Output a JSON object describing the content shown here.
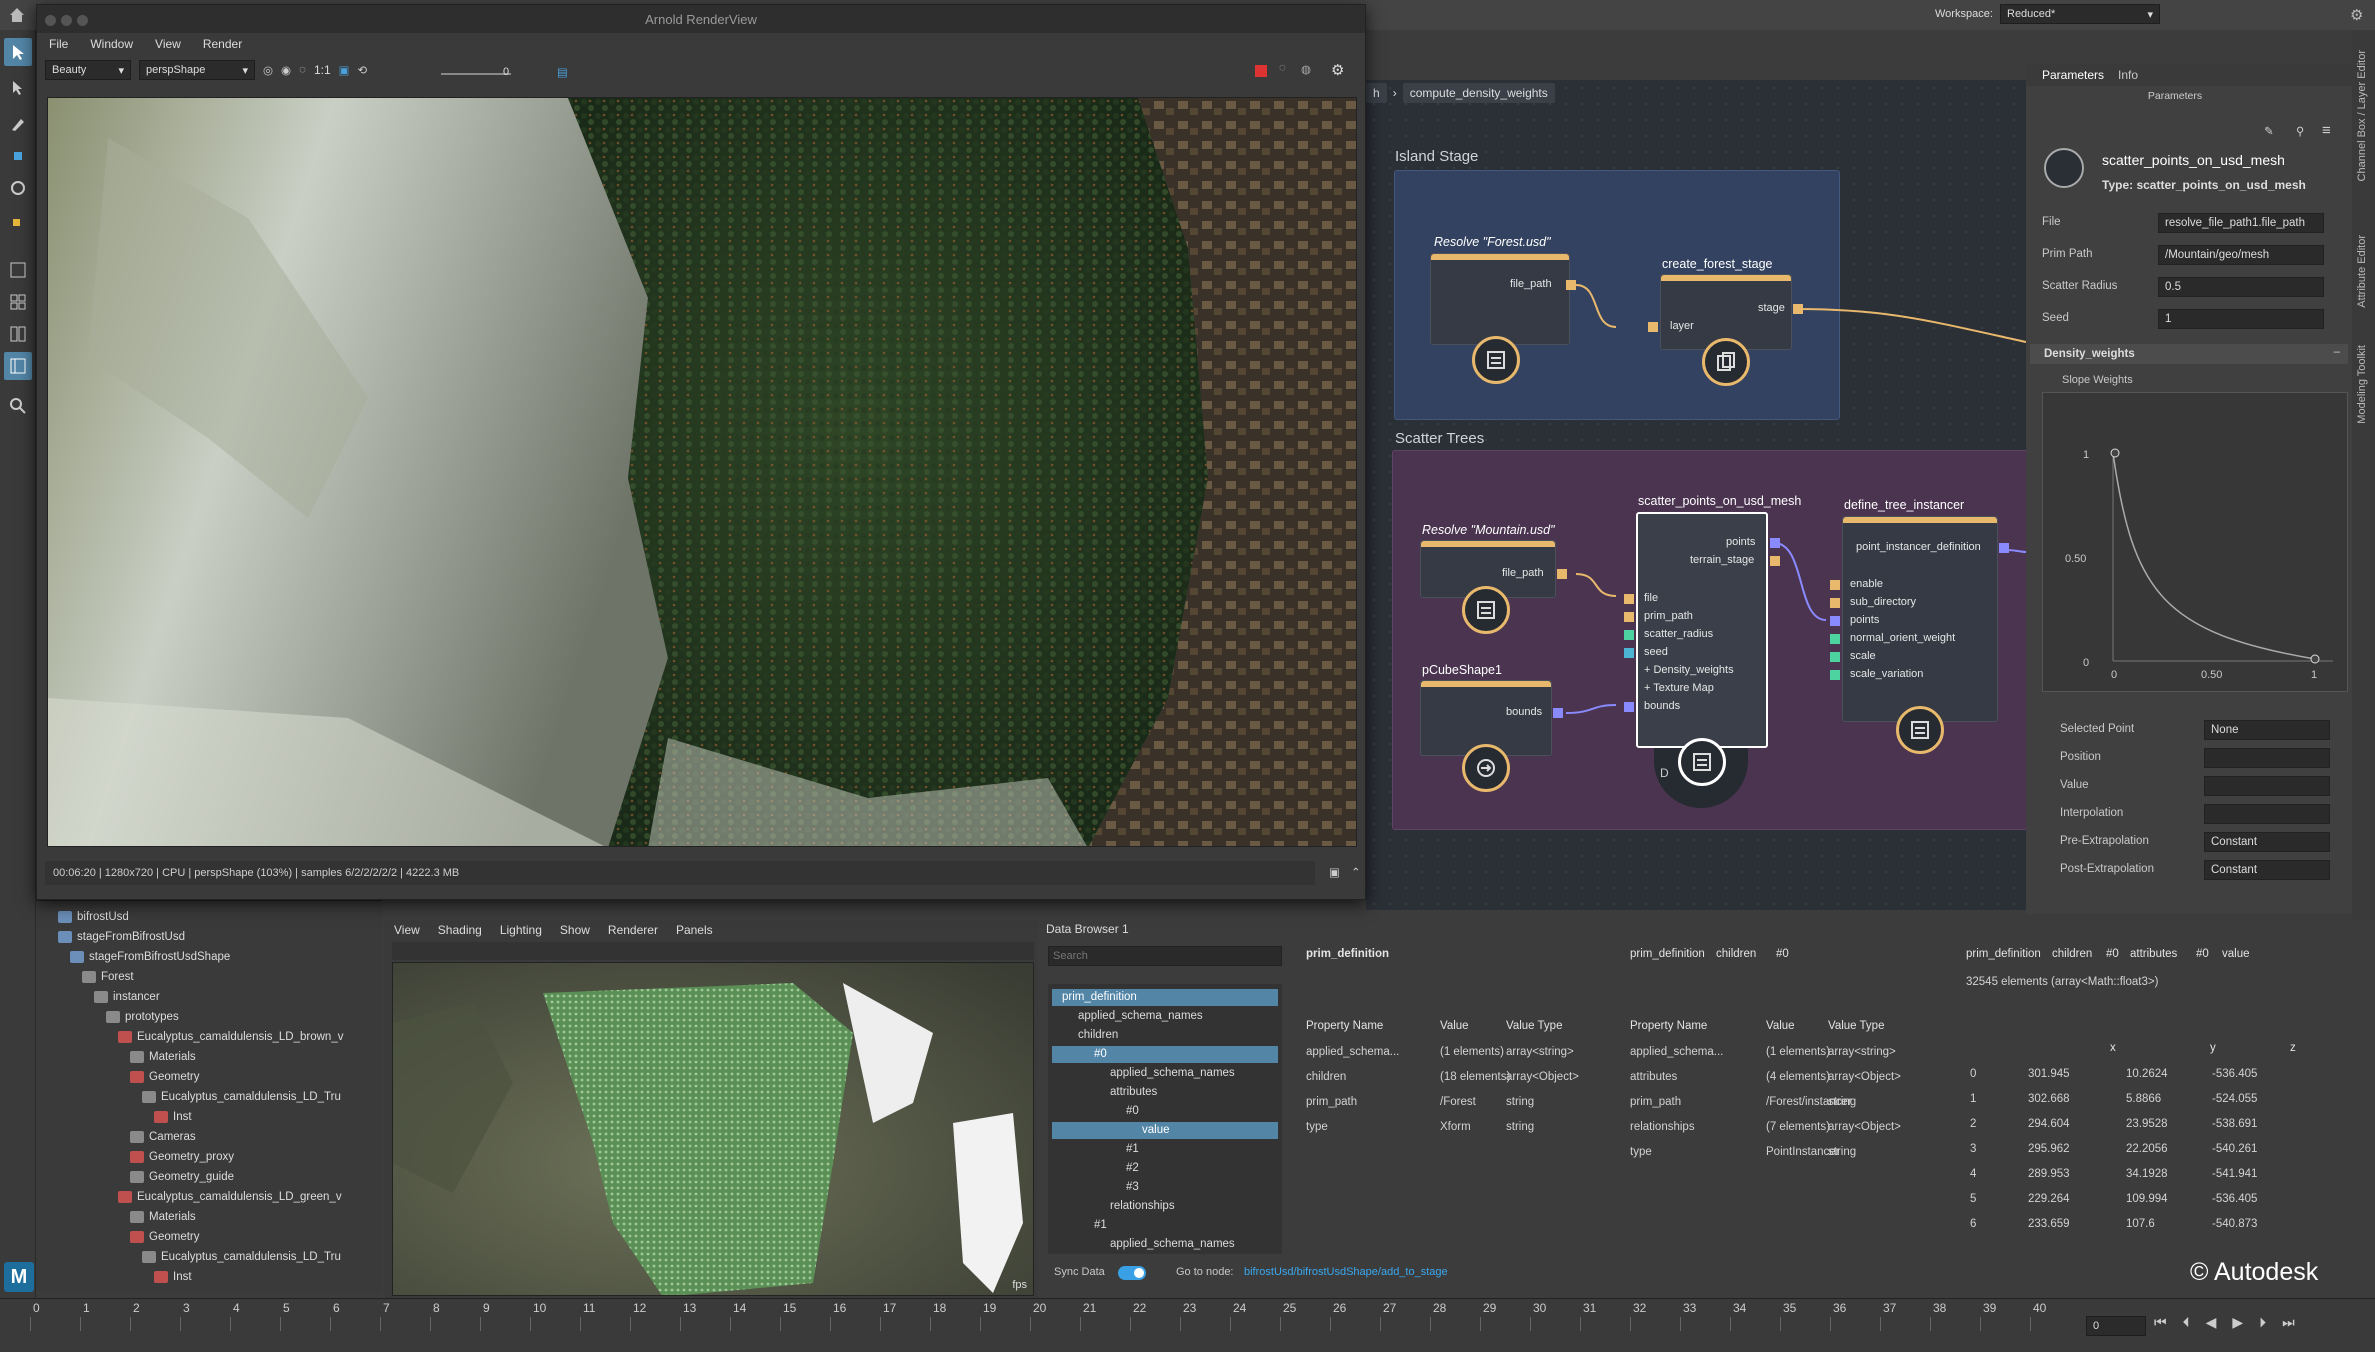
{
  "workspace": {
    "label": "Workspace:",
    "value": "Reduced*"
  },
  "renderview": {
    "title": "Arnold RenderView",
    "menu": [
      "File",
      "Window",
      "View",
      "Render"
    ],
    "aov": "Beauty",
    "camera": "perspShape",
    "ratio": "1:1",
    "exposure": "0",
    "status": "00:06:20 | 1280x720 | CPU | perspShape (103%) | samples 6/2/2/2/2/2 | 4222.3 MB"
  },
  "node_editor": {
    "breadcrumb": [
      "h",
      "compute_density_weights"
    ],
    "backdrops": {
      "island": "Island Stage",
      "scatter": "Scatter Trees"
    },
    "nodes": {
      "resolve_forest": {
        "title": "Resolve \"Forest.usd\"",
        "port": "file_path"
      },
      "create_forest_stage": {
        "title": "create_forest_stage",
        "in": "layer",
        "out": "stage"
      },
      "resolve_mountain": {
        "title": "Resolve \"Mountain.usd\"",
        "port": "file_path"
      },
      "pcube": {
        "title": "pCubeShape1",
        "port": "bounds"
      },
      "scatter": {
        "title": "scatter_points_on_usd_mesh",
        "outs": [
          "points",
          "terrain_stage"
        ],
        "ins": [
          "file",
          "prim_path",
          "scatter_radius",
          "seed",
          "+ Density_weights",
          "+ Texture Map",
          "bounds"
        ],
        "badge": "D"
      },
      "instancer": {
        "title": "define_tree_instancer",
        "out": "point_instancer_definition",
        "ins": [
          "enable",
          "sub_directory",
          "points",
          "normal_orient_weight",
          "scale",
          "scale_variation"
        ]
      }
    }
  },
  "params": {
    "tabs": [
      "Parameters",
      "Info"
    ],
    "header": "Parameters",
    "node_name": "scatter_points_on_usd_mesh",
    "node_type": "Type: scatter_points_on_usd_mesh",
    "fields": [
      {
        "label": "File",
        "value": "resolve_file_path1.file_path"
      },
      {
        "label": "Prim Path",
        "value": "/Mountain/geo/mesh"
      },
      {
        "label": "Scatter Radius",
        "value": "0.5"
      },
      {
        "label": "Seed",
        "value": "1"
      }
    ],
    "section": "Density_weights",
    "ramp_label": "Slope Weights",
    "ramp": {
      "y_ticks": [
        "1",
        "0.50",
        "0"
      ],
      "x_ticks": [
        "0",
        "0.50",
        "1"
      ]
    },
    "ramp_fields": [
      {
        "label": "Selected Point",
        "value": "None"
      },
      {
        "label": "Position",
        "value": ""
      },
      {
        "label": "Value",
        "value": ""
      },
      {
        "label": "Interpolation",
        "value": ""
      },
      {
        "label": "Pre-Extrapolation",
        "value": "Constant"
      },
      {
        "label": "Post-Extrapolation",
        "value": "Constant"
      }
    ]
  },
  "side_tabs": [
    "Channel Box / Layer Editor",
    "Attribute Editor",
    "Modeling Toolkit"
  ],
  "outliner": [
    {
      "label": "bifrostUsd",
      "indent": 0
    },
    {
      "label": "stageFromBifrostUsd",
      "indent": 0
    },
    {
      "label": "stageFromBifrostUsdShape",
      "indent": 1
    },
    {
      "label": "Forest",
      "indent": 2
    },
    {
      "label": "instancer",
      "indent": 3
    },
    {
      "label": "prototypes",
      "indent": 4
    },
    {
      "label": "Eucalyptus_camaldulensis_LD_brown_v",
      "indent": 5
    },
    {
      "label": "Materials",
      "indent": 6
    },
    {
      "label": "Geometry",
      "indent": 6
    },
    {
      "label": "Eucalyptus_camaldulensis_LD_Tru",
      "indent": 7
    },
    {
      "label": "Inst",
      "indent": 8
    },
    {
      "label": "Cameras",
      "indent": 6
    },
    {
      "label": "Geometry_proxy",
      "indent": 6
    },
    {
      "label": "Geometry_guide",
      "indent": 6
    },
    {
      "label": "Eucalyptus_camaldulensis_LD_green_v",
      "indent": 5
    },
    {
      "label": "Materials",
      "indent": 6
    },
    {
      "label": "Geometry",
      "indent": 6
    },
    {
      "label": "Eucalyptus_camaldulensis_LD_Tru",
      "indent": 7
    },
    {
      "label": "Inst",
      "indent": 8
    }
  ],
  "viewport": {
    "menu": [
      "View",
      "Shading",
      "Lighting",
      "Show",
      "Renderer",
      "Panels"
    ],
    "fps": "fps"
  },
  "data_browser": {
    "tab": "Data Browser 1",
    "search_placeholder": "Search",
    "tree": [
      {
        "label": "prim_definition",
        "indent": 0,
        "hl": true
      },
      {
        "label": "applied_schema_names",
        "indent": 1
      },
      {
        "label": "children",
        "indent": 1
      },
      {
        "label": "#0",
        "indent": 2,
        "hl": true
      },
      {
        "label": "applied_schema_names",
        "indent": 3
      },
      {
        "label": "attributes",
        "indent": 3
      },
      {
        "label": "#0",
        "indent": 4
      },
      {
        "label": "value",
        "indent": 5,
        "hl": true
      },
      {
        "label": "#1",
        "indent": 4
      },
      {
        "label": "#2",
        "indent": 4
      },
      {
        "label": "#3",
        "indent": 4
      },
      {
        "label": "relationships",
        "indent": 3
      },
      {
        "label": "#1",
        "indent": 2
      },
      {
        "label": "applied_schema_names",
        "indent": 3
      }
    ],
    "panel1": {
      "path": "prim_definition",
      "headers": [
        "Property Name",
        "Value",
        "Value Type"
      ],
      "rows": [
        [
          "applied_schema...",
          "(1 elements)",
          "array<string>"
        ],
        [
          "children",
          "(18 elements)",
          "array<Object>"
        ],
        [
          "prim_path",
          "/Forest",
          "string"
        ],
        [
          "type",
          "Xform",
          "string"
        ]
      ]
    },
    "panel2": {
      "path": [
        "prim_definition",
        "children",
        "#0"
      ],
      "headers": [
        "Property Name",
        "Value",
        "Value Type"
      ],
      "rows": [
        [
          "applied_schema...",
          "(1 elements)",
          "array<string>"
        ],
        [
          "attributes",
          "(4 elements)",
          "array<Object>"
        ],
        [
          "prim_path",
          "/Forest/instancer",
          "string"
        ],
        [
          "relationships",
          "(7 elements)",
          "array<Object>"
        ],
        [
          "type",
          "PointInstancer",
          "string"
        ]
      ]
    },
    "panel3": {
      "path": [
        "prim_definition",
        "children",
        "#0",
        "attributes",
        "#0",
        "value"
      ],
      "summary": "32545 elements (array<Math::float3>)",
      "headers": [
        "x",
        "y",
        "z"
      ],
      "rows": [
        [
          "0",
          "301.945",
          "10.2624",
          "-536.405"
        ],
        [
          "1",
          "302.668",
          "5.8866",
          "-524.055"
        ],
        [
          "2",
          "294.604",
          "23.9528",
          "-538.691"
        ],
        [
          "3",
          "295.962",
          "22.2056",
          "-540.261"
        ],
        [
          "4",
          "289.953",
          "34.1928",
          "-541.941"
        ],
        [
          "5",
          "229.264",
          "109.994",
          "-536.405"
        ],
        [
          "6",
          "233.659",
          "107.6",
          "-540.873"
        ]
      ]
    },
    "sync_label": "Sync Data",
    "goto_label": "Go to node:",
    "goto_path": "bifrostUsd/bifrostUsdShape/add_to_stage"
  },
  "copyright": "© Autodesk",
  "logo": "M",
  "timeline": {
    "ticks": [
      "0",
      "1",
      "2",
      "3",
      "4",
      "5",
      "6",
      "7",
      "8",
      "9",
      "10",
      "11",
      "12",
      "13",
      "14",
      "15",
      "16",
      "17",
      "18",
      "19",
      "20",
      "21",
      "22",
      "23",
      "24",
      "25",
      "26",
      "27",
      "28",
      "29",
      "30",
      "31",
      "32",
      "33",
      "34",
      "35",
      "36",
      "37",
      "38",
      "39",
      "40"
    ],
    "current": "0"
  }
}
